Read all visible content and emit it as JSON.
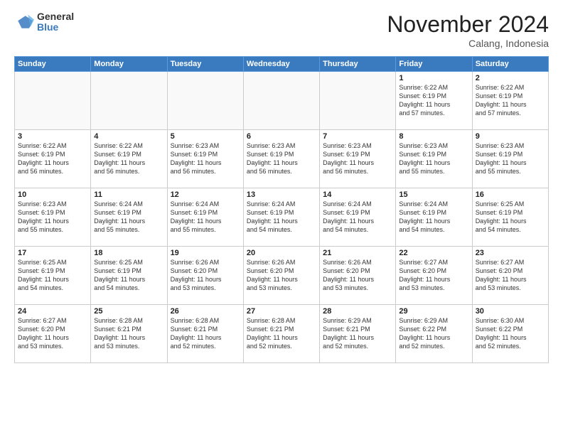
{
  "logo": {
    "general": "General",
    "blue": "Blue"
  },
  "header": {
    "month_year": "November 2024",
    "location": "Calang, Indonesia"
  },
  "weekdays": [
    "Sunday",
    "Monday",
    "Tuesday",
    "Wednesday",
    "Thursday",
    "Friday",
    "Saturday"
  ],
  "weeks": [
    [
      {
        "day": "",
        "info": ""
      },
      {
        "day": "",
        "info": ""
      },
      {
        "day": "",
        "info": ""
      },
      {
        "day": "",
        "info": ""
      },
      {
        "day": "",
        "info": ""
      },
      {
        "day": "1",
        "info": "Sunrise: 6:22 AM\nSunset: 6:19 PM\nDaylight: 11 hours\nand 57 minutes."
      },
      {
        "day": "2",
        "info": "Sunrise: 6:22 AM\nSunset: 6:19 PM\nDaylight: 11 hours\nand 57 minutes."
      }
    ],
    [
      {
        "day": "3",
        "info": "Sunrise: 6:22 AM\nSunset: 6:19 PM\nDaylight: 11 hours\nand 56 minutes."
      },
      {
        "day": "4",
        "info": "Sunrise: 6:22 AM\nSunset: 6:19 PM\nDaylight: 11 hours\nand 56 minutes."
      },
      {
        "day": "5",
        "info": "Sunrise: 6:23 AM\nSunset: 6:19 PM\nDaylight: 11 hours\nand 56 minutes."
      },
      {
        "day": "6",
        "info": "Sunrise: 6:23 AM\nSunset: 6:19 PM\nDaylight: 11 hours\nand 56 minutes."
      },
      {
        "day": "7",
        "info": "Sunrise: 6:23 AM\nSunset: 6:19 PM\nDaylight: 11 hours\nand 56 minutes."
      },
      {
        "day": "8",
        "info": "Sunrise: 6:23 AM\nSunset: 6:19 PM\nDaylight: 11 hours\nand 55 minutes."
      },
      {
        "day": "9",
        "info": "Sunrise: 6:23 AM\nSunset: 6:19 PM\nDaylight: 11 hours\nand 55 minutes."
      }
    ],
    [
      {
        "day": "10",
        "info": "Sunrise: 6:23 AM\nSunset: 6:19 PM\nDaylight: 11 hours\nand 55 minutes."
      },
      {
        "day": "11",
        "info": "Sunrise: 6:24 AM\nSunset: 6:19 PM\nDaylight: 11 hours\nand 55 minutes."
      },
      {
        "day": "12",
        "info": "Sunrise: 6:24 AM\nSunset: 6:19 PM\nDaylight: 11 hours\nand 55 minutes."
      },
      {
        "day": "13",
        "info": "Sunrise: 6:24 AM\nSunset: 6:19 PM\nDaylight: 11 hours\nand 54 minutes."
      },
      {
        "day": "14",
        "info": "Sunrise: 6:24 AM\nSunset: 6:19 PM\nDaylight: 11 hours\nand 54 minutes."
      },
      {
        "day": "15",
        "info": "Sunrise: 6:24 AM\nSunset: 6:19 PM\nDaylight: 11 hours\nand 54 minutes."
      },
      {
        "day": "16",
        "info": "Sunrise: 6:25 AM\nSunset: 6:19 PM\nDaylight: 11 hours\nand 54 minutes."
      }
    ],
    [
      {
        "day": "17",
        "info": "Sunrise: 6:25 AM\nSunset: 6:19 PM\nDaylight: 11 hours\nand 54 minutes."
      },
      {
        "day": "18",
        "info": "Sunrise: 6:25 AM\nSunset: 6:19 PM\nDaylight: 11 hours\nand 54 minutes."
      },
      {
        "day": "19",
        "info": "Sunrise: 6:26 AM\nSunset: 6:20 PM\nDaylight: 11 hours\nand 53 minutes."
      },
      {
        "day": "20",
        "info": "Sunrise: 6:26 AM\nSunset: 6:20 PM\nDaylight: 11 hours\nand 53 minutes."
      },
      {
        "day": "21",
        "info": "Sunrise: 6:26 AM\nSunset: 6:20 PM\nDaylight: 11 hours\nand 53 minutes."
      },
      {
        "day": "22",
        "info": "Sunrise: 6:27 AM\nSunset: 6:20 PM\nDaylight: 11 hours\nand 53 minutes."
      },
      {
        "day": "23",
        "info": "Sunrise: 6:27 AM\nSunset: 6:20 PM\nDaylight: 11 hours\nand 53 minutes."
      }
    ],
    [
      {
        "day": "24",
        "info": "Sunrise: 6:27 AM\nSunset: 6:20 PM\nDaylight: 11 hours\nand 53 minutes."
      },
      {
        "day": "25",
        "info": "Sunrise: 6:28 AM\nSunset: 6:21 PM\nDaylight: 11 hours\nand 53 minutes."
      },
      {
        "day": "26",
        "info": "Sunrise: 6:28 AM\nSunset: 6:21 PM\nDaylight: 11 hours\nand 52 minutes."
      },
      {
        "day": "27",
        "info": "Sunrise: 6:28 AM\nSunset: 6:21 PM\nDaylight: 11 hours\nand 52 minutes."
      },
      {
        "day": "28",
        "info": "Sunrise: 6:29 AM\nSunset: 6:21 PM\nDaylight: 11 hours\nand 52 minutes."
      },
      {
        "day": "29",
        "info": "Sunrise: 6:29 AM\nSunset: 6:22 PM\nDaylight: 11 hours\nand 52 minutes."
      },
      {
        "day": "30",
        "info": "Sunrise: 6:30 AM\nSunset: 6:22 PM\nDaylight: 11 hours\nand 52 minutes."
      }
    ]
  ]
}
